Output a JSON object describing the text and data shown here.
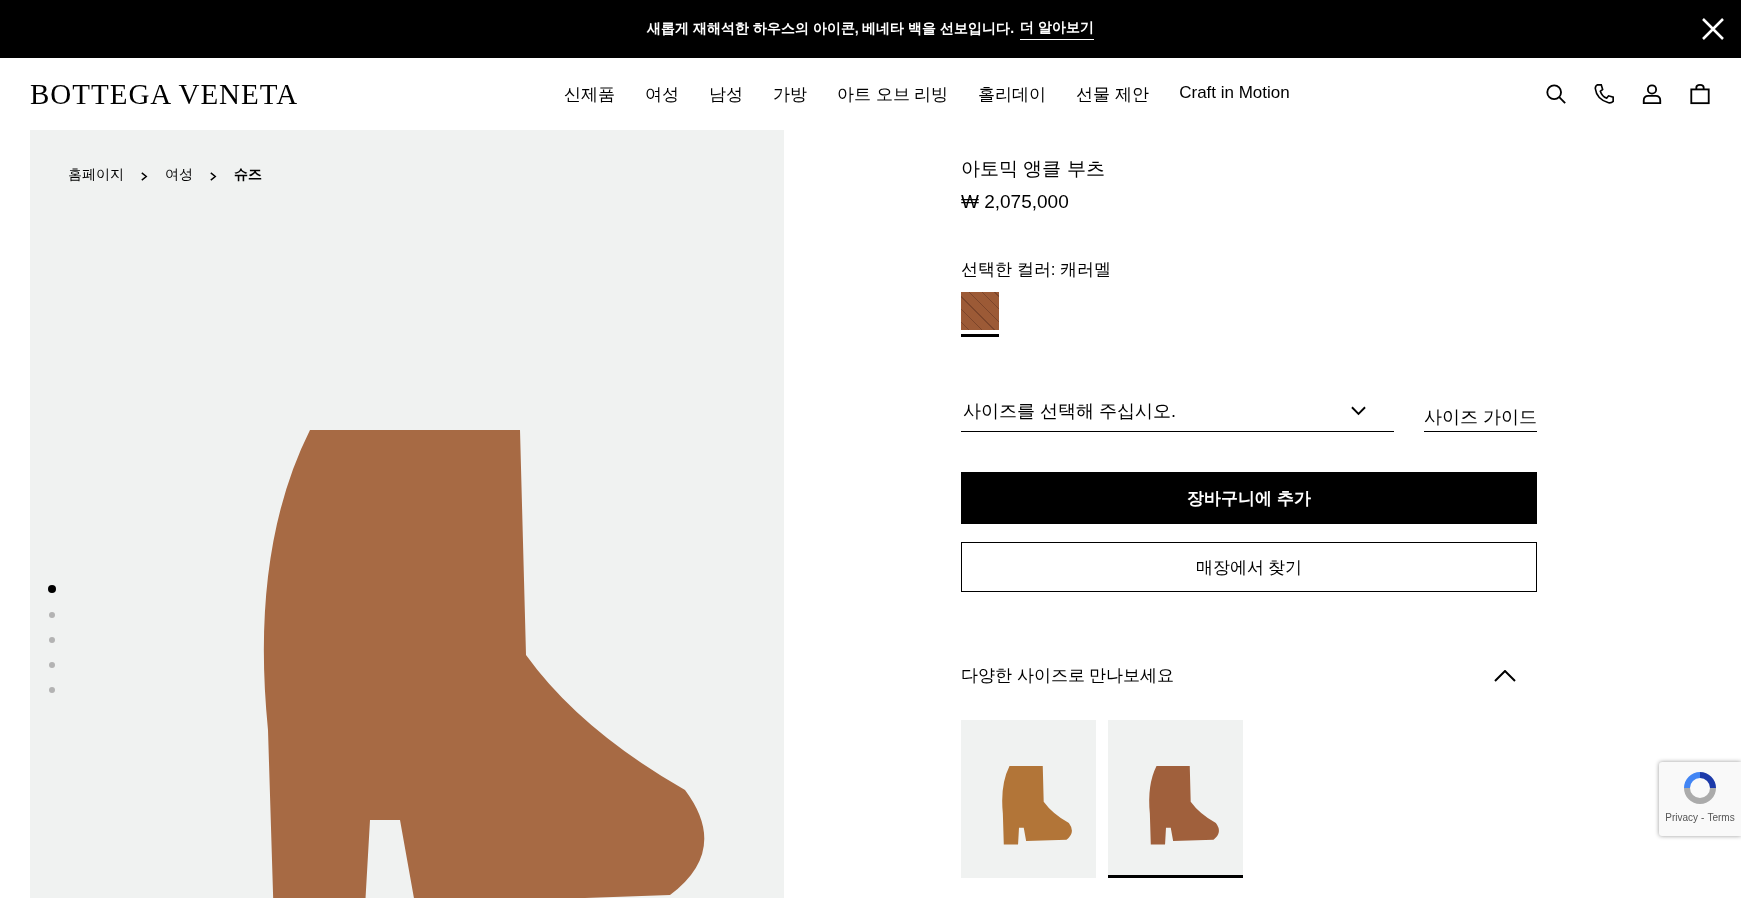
{
  "banner": {
    "text": "새롭게 재해석한 하우스의 아이콘, 베네타 백을 선보입니다.",
    "link": "더 알아보기"
  },
  "logo": "BOTTEGA VENETA",
  "nav": [
    "신제품",
    "여성",
    "남성",
    "가방",
    "아트 오브 리빙",
    "홀리데이",
    "선물 제안",
    "Craft in Motion"
  ],
  "breadcrumb": [
    {
      "label": "홈페이지",
      "current": false
    },
    {
      "label": "여성",
      "current": false
    },
    {
      "label": "슈즈",
      "current": true
    }
  ],
  "gallery": {
    "dots": [
      {
        "selected": true
      },
      {
        "selected": false
      },
      {
        "selected": false
      },
      {
        "selected": false
      },
      {
        "selected": false
      }
    ]
  },
  "product": {
    "title": "아토믹 앵클 부츠",
    "price": "₩ 2,075,000",
    "color_label": "선택한 컬러: 캐러멜",
    "swatches": [
      {
        "selected": true
      }
    ],
    "size_select": {
      "placeholder": "사이즈를 선택해 주십시오."
    },
    "size_guide": "사이즈 가이드",
    "add_to_cart": "장바구니에 추가",
    "find_store": "매장에서 찾기"
  },
  "sizes_section": {
    "title": "다양한 사이즈로 만나보세요",
    "expanded": true,
    "items": [
      {
        "selected": false
      },
      {
        "selected": true
      }
    ]
  },
  "recaptcha": {
    "privacy": "Privacy",
    "separator": "-",
    "terms": "Terms"
  }
}
